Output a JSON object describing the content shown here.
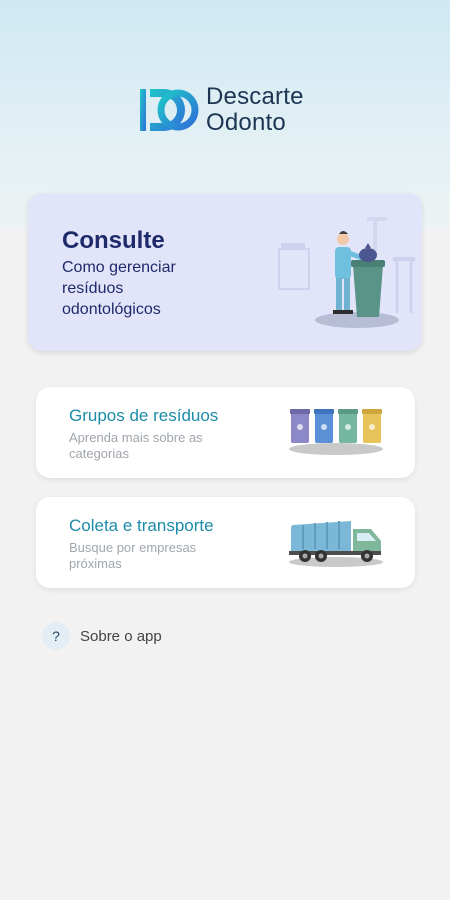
{
  "logo": {
    "line1": "Descarte",
    "line2": "Odonto",
    "brand_colors": [
      "#1fb6c9",
      "#3a6fd8"
    ]
  },
  "consult": {
    "title": "Consulte",
    "subtitle": "Como gerenciar resíduos odontológicos",
    "illustration": "person-trash-bin-icon"
  },
  "cards": [
    {
      "title": "Grupos de resíduos",
      "subtitle": "Aprenda mais sobre as categorias",
      "illustration": "waste-bins-icon"
    },
    {
      "title": "Coleta e transporte",
      "subtitle": "Busque por empresas próximas",
      "illustration": "garbage-truck-icon"
    }
  ],
  "about": {
    "icon": "?",
    "label": "Sobre o app"
  },
  "colors": {
    "accent": "#1d8ba8",
    "consult_bg": "#e2e4f9",
    "consult_text": "#1f2a6b"
  }
}
